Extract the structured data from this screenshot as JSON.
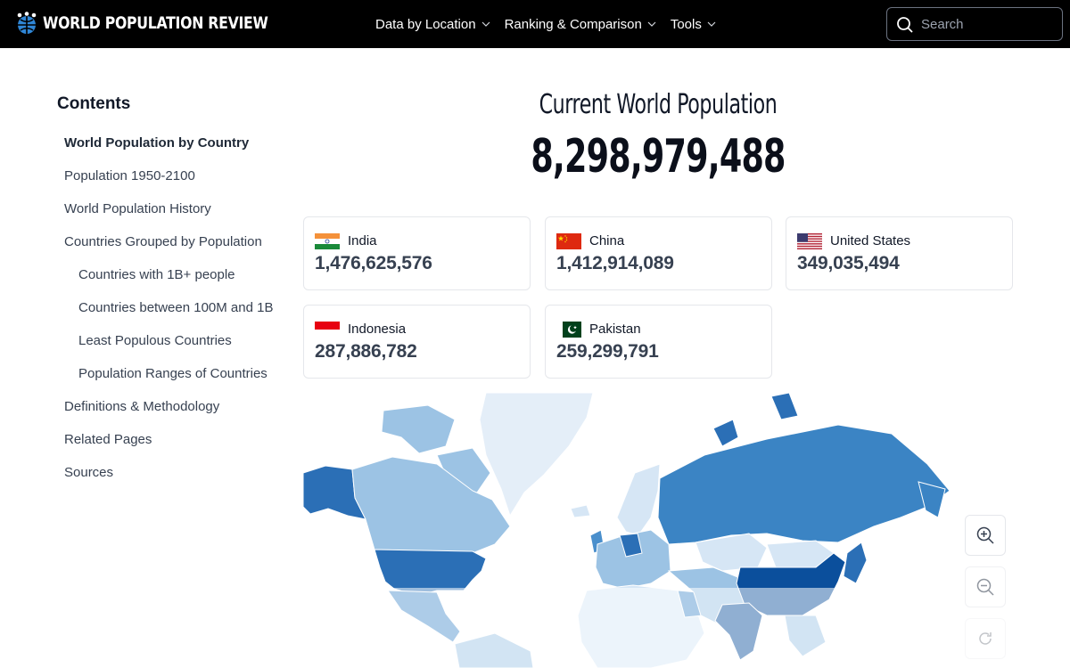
{
  "header": {
    "brand": "WORLD POPULATION REVIEW",
    "nav": [
      {
        "label": "Data by Location"
      },
      {
        "label": "Ranking & Comparison"
      },
      {
        "label": "Tools"
      }
    ],
    "search": {
      "placeholder": "Search",
      "value": ""
    }
  },
  "sidebar": {
    "heading": "Contents",
    "items": [
      {
        "label": "World Population by Country"
      },
      {
        "label": "Population 1950-2100"
      },
      {
        "label": "World Population History"
      },
      {
        "label": "Countries Grouped by Population"
      },
      {
        "label": "Countries with 1B+ people"
      },
      {
        "label": "Countries between 100M and 1B"
      },
      {
        "label": "Least Populous Countries"
      },
      {
        "label": "Population Ranges of Countries"
      },
      {
        "label": "Definitions & Methodology"
      },
      {
        "label": "Related Pages"
      },
      {
        "label": "Sources"
      }
    ]
  },
  "main": {
    "title": "Current World Population",
    "world_population": "8,298,979,488",
    "top_countries": [
      {
        "name": "India",
        "population": "1,476,625,576"
      },
      {
        "name": "China",
        "population": "1,412,914,089"
      },
      {
        "name": "United States",
        "population": "349,035,494"
      },
      {
        "name": "Indonesia",
        "population": "287,886,782"
      },
      {
        "name": "Pakistan",
        "population": "259,299,791"
      }
    ]
  },
  "map": {
    "colors": {
      "highest": "#0b4f9c",
      "high": "#2b6fb6",
      "medium": "#4a8fcc",
      "low": "#9cc3e4",
      "lowest": "#d6e6f5"
    }
  }
}
